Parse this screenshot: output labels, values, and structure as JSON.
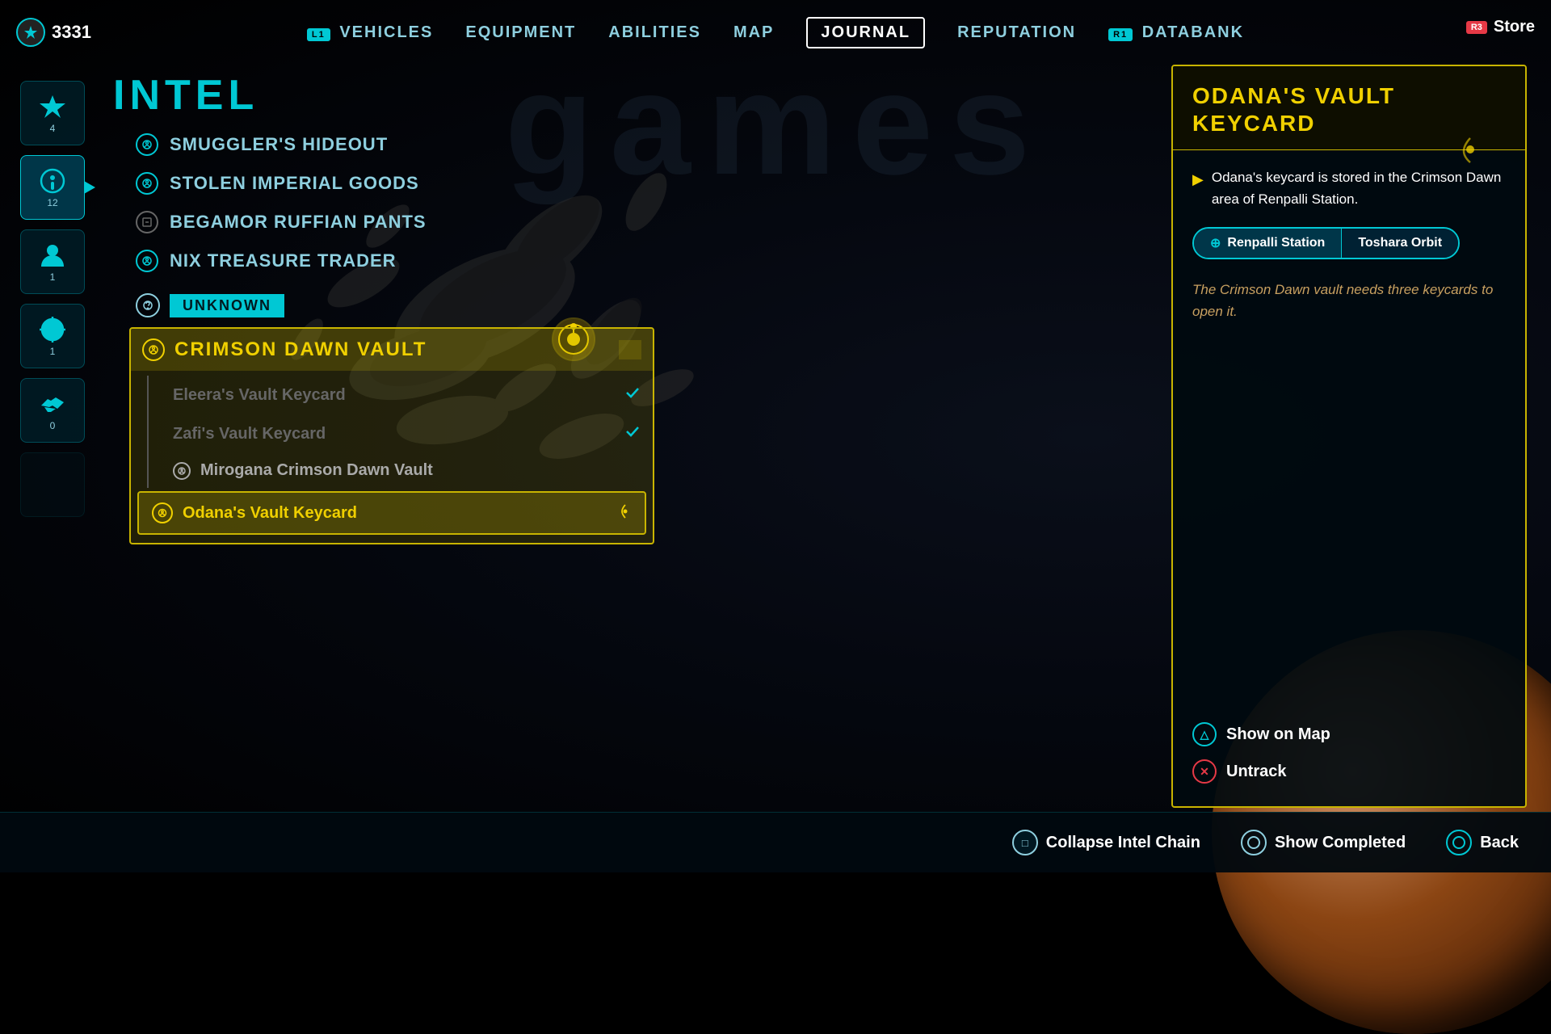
{
  "currency": {
    "icon": "⚡",
    "amount": "3331"
  },
  "store": {
    "badge": "R3",
    "label": "Store"
  },
  "nav": {
    "items": [
      {
        "id": "vehicles",
        "label": "VEHICLES",
        "hint": "",
        "badge": "L1"
      },
      {
        "id": "equipment",
        "label": "EQUIPMENT",
        "hint": ""
      },
      {
        "id": "abilities",
        "label": "ABILITIES",
        "hint": ""
      },
      {
        "id": "map",
        "label": "MAP",
        "hint": ""
      },
      {
        "id": "journal",
        "label": "JOURNAL",
        "hint": "",
        "active": true
      },
      {
        "id": "reputation",
        "label": "REPUTATION",
        "hint": ""
      },
      {
        "id": "databank",
        "label": "DATABANK",
        "hint": "",
        "badge": "R1"
      }
    ]
  },
  "sidebar": {
    "icons": [
      {
        "id": "objectives",
        "count": "4",
        "active": false
      },
      {
        "id": "intel",
        "count": "12",
        "active": true
      },
      {
        "id": "person",
        "count": "1",
        "active": false
      },
      {
        "id": "target",
        "count": "1",
        "active": false
      },
      {
        "id": "handshake",
        "count": "0",
        "active": false
      },
      {
        "id": "blank",
        "count": "",
        "active": false
      }
    ]
  },
  "section": {
    "title": "INTEL"
  },
  "intel_items": [
    {
      "id": "smugglers-hideout",
      "label": "SMUGGLER'S HIDEOUT"
    },
    {
      "id": "stolen-imperial-goods",
      "label": "STOLEN IMPERIAL GOODS"
    },
    {
      "id": "begamor-ruffian-pants",
      "label": "BEGAMOR RUFFIAN PANTS"
    },
    {
      "id": "nix-treasure-trader",
      "label": "NIX TREASURE TRADER"
    }
  ],
  "category": {
    "label": "UNKNOWN"
  },
  "mission": {
    "name": "CRIMSON DAWN VAULT",
    "sub_items": [
      {
        "id": "eleeras-vault-keycard",
        "label": "Eleera's Vault Keycard",
        "completed": true
      },
      {
        "id": "zafis-vault-keycard",
        "label": "Zafi's Vault Keycard",
        "completed": true
      },
      {
        "id": "mirogana-crimson-dawn-vault",
        "label": "Mirogana Crimson Dawn Vault",
        "completed": false
      },
      {
        "id": "odanas-vault-keycard",
        "label": "Odana's Vault Keycard",
        "active": true
      }
    ]
  },
  "detail": {
    "title": "ODANA'S VAULT KEYCARD",
    "description": "Odana's keycard is stored in the Crimson Dawn area of Renpalli Station.",
    "location_tags": [
      {
        "id": "renpalli-station",
        "label": "Renpalli Station",
        "active": true
      },
      {
        "id": "toshara-orbit",
        "label": "Toshara Orbit",
        "active": false
      }
    ],
    "flavor_text": "The Crimson Dawn vault needs three keycards to open it.",
    "actions": [
      {
        "id": "show-on-map",
        "button": "△",
        "label": "Show on Map",
        "style": "triangle"
      },
      {
        "id": "untrack",
        "button": "✕",
        "label": "Untrack",
        "style": "cross"
      }
    ]
  },
  "bottom_actions": [
    {
      "id": "collapse-intel-chain",
      "button": "□",
      "label": "Collapse Intel Chain",
      "style": "square"
    },
    {
      "id": "show-completed",
      "button": "○",
      "label": "Show Completed",
      "style": "circle-btn"
    },
    {
      "id": "back",
      "button": "○",
      "label": "Back",
      "style": "circle-back"
    }
  ],
  "watermark": "games"
}
